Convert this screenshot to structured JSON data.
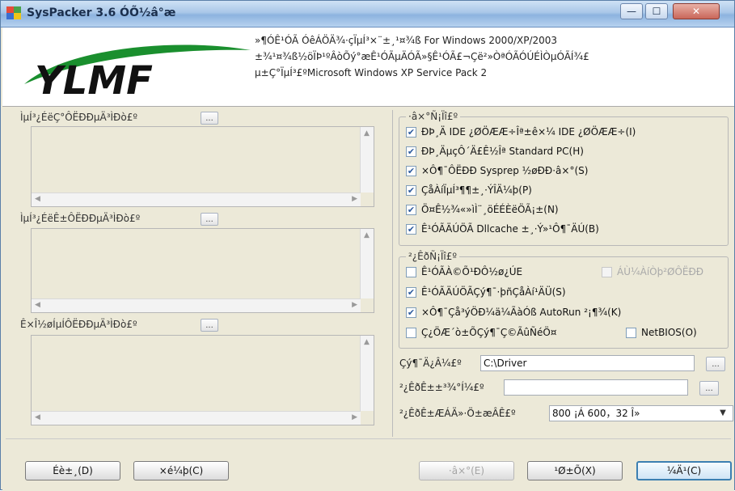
{
  "window": {
    "title": "SysPacker 3.6 ÓÕ½â°æ",
    "controls": {
      "minimize": "—",
      "maximize": "☐",
      "close": "✕"
    }
  },
  "header": {
    "logo_text": "YLMF",
    "line1": "»¶Ó­Ê¹ÓÃ ÓêÁÖÄ¾·çÏµÍ³×¨±¸¹¤¾ß For Windows 2000/XP/2003",
    "line2": "±¾¹¤¾ß½öÏÞ¹ºÂòÕý°æÊ¹ÓÃµÄÓÃ»§Ê¹ÓÃ£¬Çë²»ÒªÓÃÓÚÉÌÒµÓÃÍ¾£",
    "line3": "µ±Ç°ÏµÍ³£ºMicrosoft Windows XP Service Pack 2"
  },
  "left": {
    "box1_label": "ÌµÍ³¿ÉëÇ°ÔËÐÐµÄ³ÌÐò£º",
    "box2_label": "ÌµÍ³¿ÉëÊ±ÔËÐÐµÄ³ÌÐò£º",
    "box3_label": "Ê×Î½øÍµÍÔËÐÐµÄ³ÌÐò£º",
    "browse_label": "..."
  },
  "settings_group": {
    "title": "·â×°Ñ¡Ïî£º",
    "items": [
      {
        "label": "ÐÞ¸Ä IDE ¿ØÖÆÆ÷Îª±ê×¼ IDE ¿ØÖÆÆ÷(I)",
        "checked": true
      },
      {
        "label": "ÐÞ¸ÄµçÔ´Ä£Ê½Îª Standard PC(H)",
        "checked": true
      },
      {
        "label": "×Ô¶¯ÔËÐÐ Sysprep ½øÐÐ·â×°(S)",
        "checked": true
      },
      {
        "label": "ÇåÀíÏµÍ³¶¶±¸·ÝÎÄ¼þ(P)",
        "checked": true
      },
      {
        "label": "Ö¤Ê½¾«»ìÌ¨¸öÉÉÈëÖÃ¡±(N)",
        "checked": true
      },
      {
        "label": "Ê¹ÓÃÄÚÖÃ Dllcache ±¸·Ý»¹Ô­¶¯ÄÚ(B)",
        "checked": true
      }
    ]
  },
  "deploy_group": {
    "title": "²¿ÊðÑ¡Ïî£º",
    "items": [
      {
        "label": "Ê¹ÓÃÀ©Õ¹ÐÔ½ø¿ÚE",
        "checked": false,
        "extra_label": "ÁÙ¼ÀíÒþ²ØÔËÐÐ",
        "extra_checked": false,
        "extra_disabled": true
      },
      {
        "label": "Ê¹ÓÃÄÚÖÃÇý¶¯·þñÇåÀí¹ÄÜ(S)",
        "checked": true
      },
      {
        "label": "×Ô¶¯Çå³ýÖÐ¼ä¼ÃàÓß AutoRun ²¡¶¾(K)",
        "checked": true
      },
      {
        "label": "Ç¿ÖÆ´ò±ÕÇý¶¯Ç©ÃûÑéÖ¤",
        "checked": false,
        "extra_label": "NetBIOS(O)",
        "extra_checked": false,
        "extra_disabled": false
      }
    ]
  },
  "fields": {
    "driver_label": "Çý¶¯Ä¿Â¼£º",
    "driver_value": "C:\\Driver",
    "deploy_label": "²¿ÊðÊ±±³¾°Í¼£º",
    "deploy_value": "",
    "resolution_label": "²¿ÊðÊ±ÆÁÄ»·Ö±æÂÊ£º",
    "resolution_value": "800 ¡Á 600，32 Î»",
    "browse_label": "..."
  },
  "buttons": {
    "settings": "Éè±¸(D)",
    "help": "×é¼þ(C)",
    "pack": "·â×°(E)",
    "close": "¹Ø±Õ(X)",
    "about": "¼Ä¹(C)"
  },
  "colors": {
    "logo_green": "#1a8f2e",
    "logo_dark": "#111111",
    "check_blue": "#2d5b9e"
  }
}
